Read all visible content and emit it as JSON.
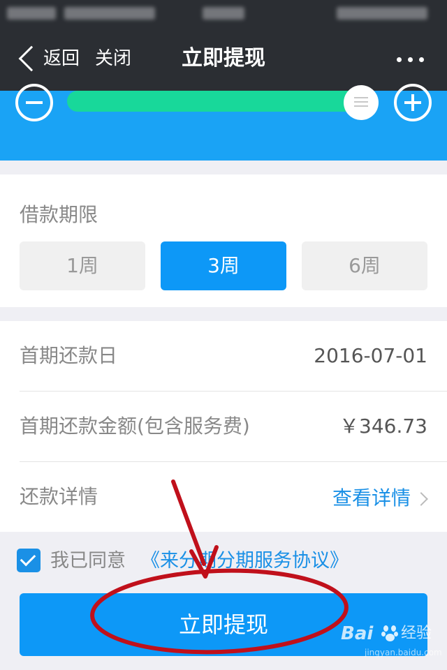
{
  "nav": {
    "back_label": "返回",
    "close_label": "关闭",
    "title": "立即提现"
  },
  "amount_slider": {
    "level": 0.93
  },
  "loan_term": {
    "label": "借款期限",
    "options": [
      "1周",
      "3周",
      "6周"
    ],
    "selected": "3周"
  },
  "repayment": {
    "first_date_label": "首期还款日",
    "first_date_value": "2016-07-01",
    "first_amount_label": "首期还款金额(包含服务费)",
    "first_amount_value": "￥346.73",
    "details_label": "还款详情",
    "details_link": "查看详情"
  },
  "agreement": {
    "checked": true,
    "text": "我已同意",
    "link_text": "《来分期分期服务协议》"
  },
  "submit_label": "立即提现",
  "watermark": {
    "logo": "Bai",
    "name": "经验",
    "url": "jingyan.baidu.com"
  },
  "colors": {
    "nav_bg": "#2b2e33",
    "panel_blue": "#1aa3f5",
    "slider_green": "#18d89a",
    "primary": "#0d98f7",
    "link": "#1a90e6",
    "annotation_red": "#c0101b"
  },
  "icons": [
    "back-chevron-icon",
    "more-icon",
    "minus-circle-icon",
    "plus-circle-icon",
    "slider-handle-icon",
    "checkbox-checked-icon",
    "chevron-right-icon",
    "baidu-paw-icon"
  ]
}
